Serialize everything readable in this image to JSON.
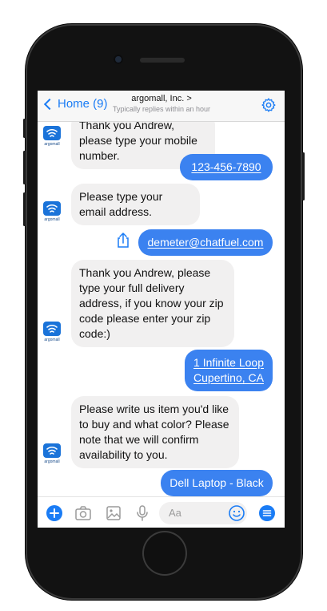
{
  "header": {
    "back_label": "Home (9)",
    "title": "argomall, Inc. >",
    "subtitle": "Typically replies within an hour"
  },
  "avatar_text": "argomall",
  "messages": [
    {
      "from": "bot",
      "text": "Thank you Andrew, please type your mobile number."
    },
    {
      "from": "user",
      "text": "123-456-7890"
    },
    {
      "from": "bot",
      "text": "Please type your email address."
    },
    {
      "from": "user",
      "text": "demeter@chatfuel.com"
    },
    {
      "from": "bot",
      "text": "Thank you Andrew, please type your full delivery address, if you know your zip code please enter your zip code:)"
    },
    {
      "from": "user",
      "line1": "1 Infinite Loop",
      "line2": "Cupertino, CA"
    },
    {
      "from": "bot",
      "text": "Please write us item you'd like to buy and what color? Please note that we will confirm availability to you."
    },
    {
      "from": "user",
      "text": "Dell Laptop - Black"
    }
  ],
  "composer": {
    "placeholder": "Aa",
    "icons": [
      "plus-icon",
      "camera-icon",
      "gallery-icon",
      "microphone-icon",
      "emoji-icon",
      "menu-icon"
    ]
  },
  "colors": {
    "accent": "#1a7cf5",
    "user_bubble": "#3b82f0",
    "bot_bubble": "#f1f0f0",
    "phone_body": "#121212"
  }
}
